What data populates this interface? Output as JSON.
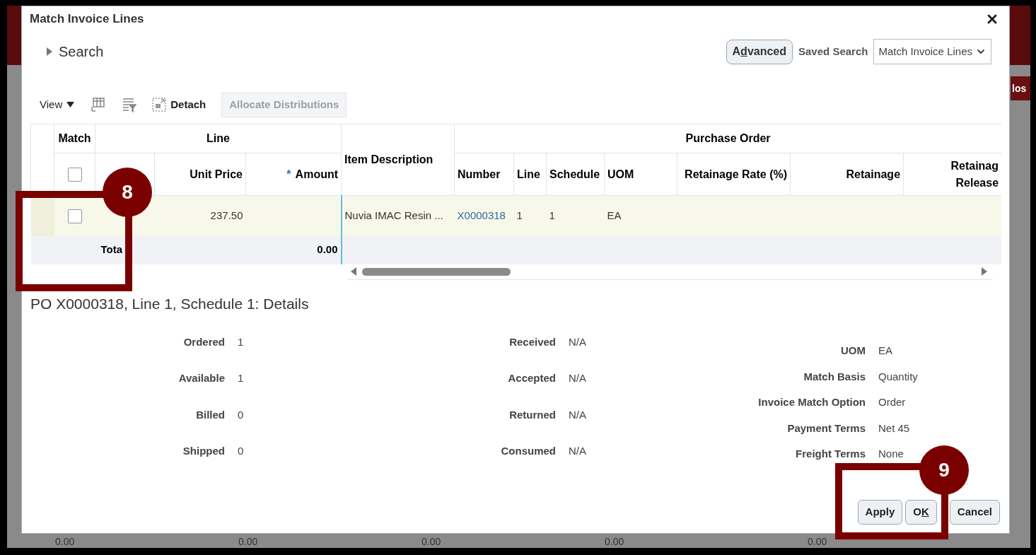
{
  "background": {
    "side_button": "los",
    "footer_values": [
      "0.00",
      "0.00",
      "0.00",
      "0.00",
      "0.00"
    ]
  },
  "dialog": {
    "title": "Match Invoice Lines",
    "search": {
      "label": "Search",
      "expanded": false
    },
    "advanced_button": {
      "label_parts": [
        {
          "text": "A",
          "underlined": false
        },
        {
          "text": "d",
          "underlined": true
        },
        {
          "text": "vanced",
          "underlined": false
        }
      ]
    },
    "saved_search": {
      "label": "Saved Search",
      "value": "Match Invoice Lines"
    },
    "toolbar": {
      "view": "View",
      "detach": "Detach",
      "allocate": {
        "label": "Allocate Distributions",
        "disabled": true
      }
    },
    "table": {
      "groups": {
        "match": "Match",
        "line": "Line",
        "po": "Purchase Order"
      },
      "header_checked": false,
      "columns": [
        "",
        "Unit Price",
        "Amount",
        "Item Description",
        "Number",
        "Line",
        "Schedule",
        "UOM",
        "Retainage Rate (%)",
        "Retainage",
        "Retainag Release"
      ],
      "amount_required_mark": "*",
      "rows": [
        {
          "checked": false,
          "selected": true,
          "cells": [
            "",
            "237.50",
            "",
            "Nuvia IMAC Resin ...",
            "X0000318",
            "1",
            "1",
            "EA",
            "",
            "",
            ""
          ]
        }
      ],
      "total": {
        "label": "Tota",
        "amount": "0.00"
      }
    },
    "details": {
      "title": "PO X0000318, Line 1, Schedule 1: Details",
      "columns": [
        [
          {
            "label": "Ordered",
            "value": "1"
          },
          {
            "label": "Available",
            "value": "1"
          },
          {
            "label": "Billed",
            "value": "0"
          },
          {
            "label": "Shipped",
            "value": "0"
          }
        ],
        [
          {
            "label": "Received",
            "value": "N/A"
          },
          {
            "label": "Accepted",
            "value": "N/A"
          },
          {
            "label": "Returned",
            "value": "N/A"
          },
          {
            "label": "Consumed",
            "value": "N/A"
          }
        ],
        [
          {
            "label": "UOM",
            "value": "EA"
          },
          {
            "label": "Match Basis",
            "value": "Quantity"
          },
          {
            "label": "Invoice Match Option",
            "value": "Order"
          },
          {
            "label": "Payment Terms",
            "value": "Net 45"
          },
          {
            "label": "Freight Terms",
            "value": "None"
          }
        ]
      ]
    },
    "buttons": [
      {
        "label_parts": [
          {
            "text": "Apply",
            "underlined": false
          }
        ]
      },
      {
        "label_parts": [
          {
            "text": "O",
            "underlined": false
          },
          {
            "text": "K",
            "underlined": true
          }
        ]
      },
      {
        "label_parts": [
          {
            "text": "Cancel",
            "underlined": false
          }
        ]
      }
    ]
  },
  "annotations": [
    {
      "number": "8"
    },
    {
      "number": "9"
    }
  ]
}
